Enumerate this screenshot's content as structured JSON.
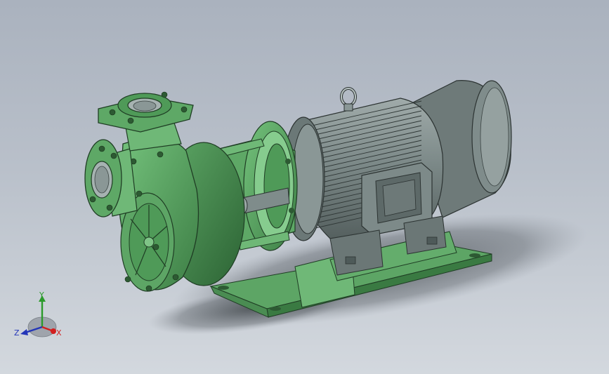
{
  "triad": {
    "x_label": "X",
    "y_label": "Y",
    "z_label": "Z",
    "x_color": "#d21f1f",
    "y_color": "#2b9a2b",
    "z_color": "#2336b8"
  },
  "colors": {
    "pump_green": "#4f9a58",
    "pump_green_light": "#6fbf78",
    "pump_green_dark": "#2f6b38",
    "motor_gray": "#7c8a89",
    "motor_gray_dark": "#4e5a59",
    "motor_gray_light": "#a6b2b1",
    "background_top": "#aab2be",
    "background_bottom": "#d3d8de"
  },
  "icons": {
    "triad": "coordinate-triad-icon",
    "lifting_eye": "lifting-eye-icon"
  }
}
